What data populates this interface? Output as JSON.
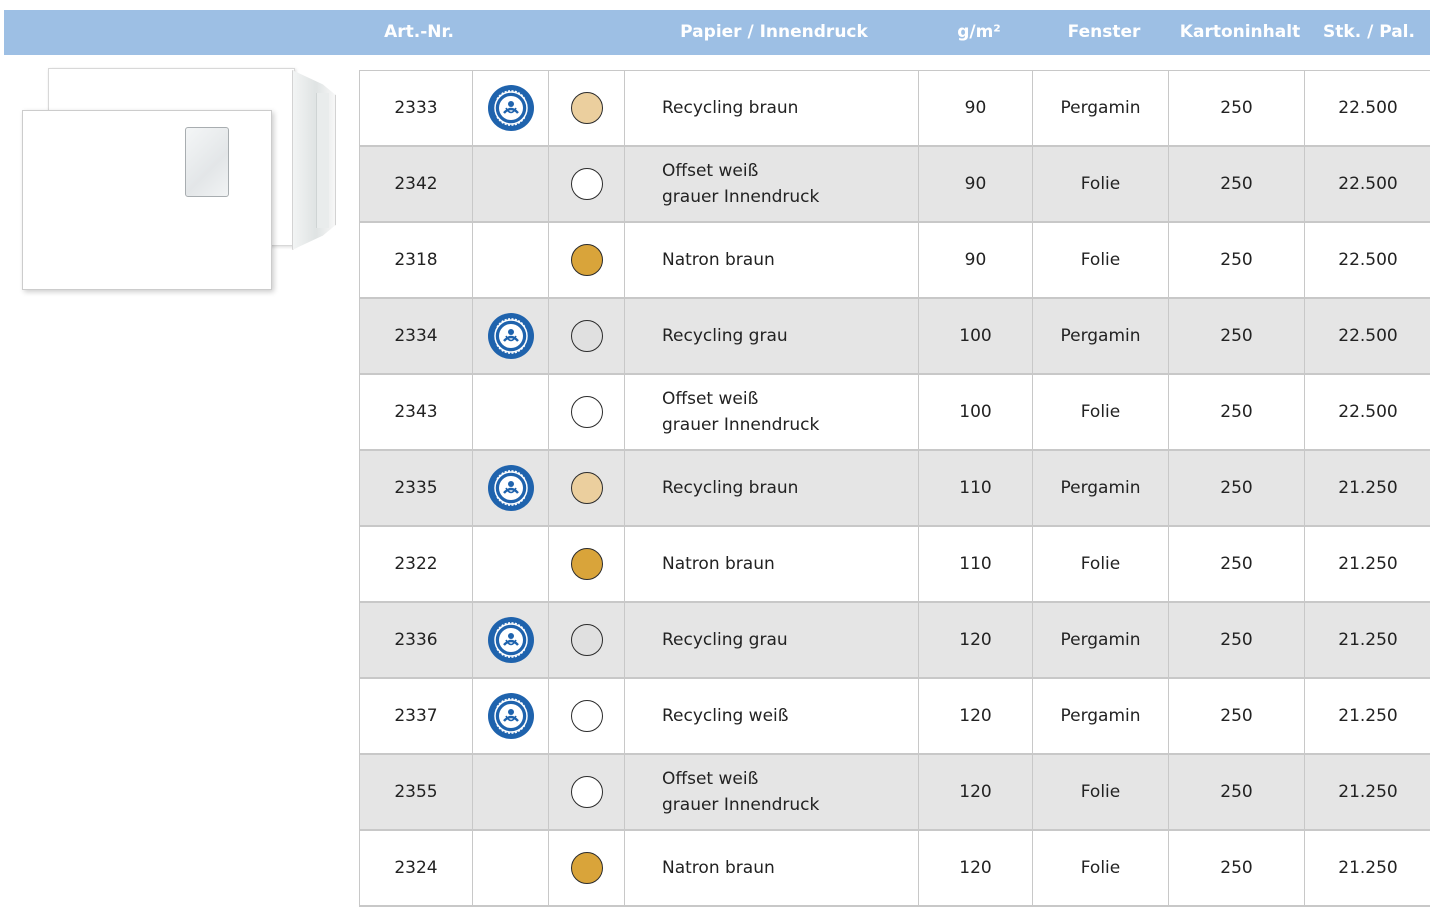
{
  "header": {
    "art_nr": "Art.-Nr.",
    "papier": "Papier / Innendruck",
    "gsm": "g/m²",
    "fenster": "Fenster",
    "karton": "Kartoninhalt",
    "pal": "Stk. / Pal."
  },
  "colors": {
    "header_bg": "#9dbfe4",
    "row_shaded": "#e5e5e5",
    "swatch_recycling_braun": "#ebcf9e",
    "swatch_natron_braun": "#d9a43a",
    "swatch_grau": "#e0e0e0",
    "swatch_weiss": "#ffffff",
    "badge_blue": "#1f63ad"
  },
  "badge_icon": "blauer-engel-eco-label-icon",
  "rows": [
    {
      "art": "2333",
      "blauer_engel": true,
      "swatch": "#ebcf9e",
      "paper": [
        "Recycling braun"
      ],
      "gsm": "90",
      "fenster": "Pergamin",
      "karton": "250",
      "pal": "22.500"
    },
    {
      "art": "2342",
      "blauer_engel": false,
      "swatch": "#ffffff",
      "paper": [
        "Offset weiß",
        "grauer Innendruck"
      ],
      "gsm": "90",
      "fenster": "Folie",
      "karton": "250",
      "pal": "22.500"
    },
    {
      "art": "2318",
      "blauer_engel": false,
      "swatch": "#d9a43a",
      "paper": [
        "Natron braun"
      ],
      "gsm": "90",
      "fenster": "Folie",
      "karton": "250",
      "pal": "22.500"
    },
    {
      "art": "2334",
      "blauer_engel": true,
      "swatch": "#e0e0e0",
      "paper": [
        "Recycling grau"
      ],
      "gsm": "100",
      "fenster": "Pergamin",
      "karton": "250",
      "pal": "22.500"
    },
    {
      "art": "2343",
      "blauer_engel": false,
      "swatch": "#ffffff",
      "paper": [
        "Offset weiß",
        "grauer Innendruck"
      ],
      "gsm": "100",
      "fenster": "Folie",
      "karton": "250",
      "pal": "22.500"
    },
    {
      "art": "2335",
      "blauer_engel": true,
      "swatch": "#ebcf9e",
      "paper": [
        "Recycling braun"
      ],
      "gsm": "110",
      "fenster": "Pergamin",
      "karton": "250",
      "pal": "21.250"
    },
    {
      "art": "2322",
      "blauer_engel": false,
      "swatch": "#d9a43a",
      "paper": [
        "Natron braun"
      ],
      "gsm": "110",
      "fenster": "Folie",
      "karton": "250",
      "pal": "21.250"
    },
    {
      "art": "2336",
      "blauer_engel": true,
      "swatch": "#e0e0e0",
      "paper": [
        "Recycling grau"
      ],
      "gsm": "120",
      "fenster": "Pergamin",
      "karton": "250",
      "pal": "21.250"
    },
    {
      "art": "2337",
      "blauer_engel": true,
      "swatch": "#ffffff",
      "paper": [
        "Recycling weiß"
      ],
      "gsm": "120",
      "fenster": "Pergamin",
      "karton": "250",
      "pal": "21.250"
    },
    {
      "art": "2355",
      "blauer_engel": false,
      "swatch": "#ffffff",
      "paper": [
        "Offset weiß",
        "grauer Innendruck"
      ],
      "gsm": "120",
      "fenster": "Folie",
      "karton": "250",
      "pal": "21.250"
    },
    {
      "art": "2324",
      "blauer_engel": false,
      "swatch": "#d9a43a",
      "paper": [
        "Natron braun"
      ],
      "gsm": "120",
      "fenster": "Folie",
      "karton": "250",
      "pal": "21.250"
    }
  ]
}
